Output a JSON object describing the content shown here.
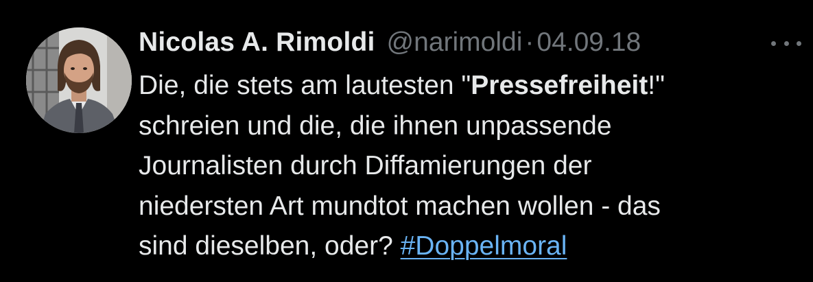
{
  "tweet": {
    "author": {
      "display_name": "Nicolas A. Rimoldi",
      "handle": "@narimoldi",
      "avatar_icon": "profile-photo"
    },
    "separator": "·",
    "date": "04.09.18",
    "more_icon": "ellipsis-icon",
    "text": {
      "line1_a": "Die, die stets am lautesten \"",
      "line1_bold": "Pressefreiheit",
      "line1_b": "!\"",
      "line2": "schreien und die, die ihnen unpassende",
      "line3": "Journalisten durch Diffamierungen der",
      "line4": "niedersten Art mundtot machen wollen - das",
      "line5_a": "sind dieselben, oder? ",
      "hashtag": "#Doppelmoral"
    }
  },
  "colors": {
    "background": "#000000",
    "primary_text": "#e7e9ea",
    "secondary_text": "#71767b",
    "link": "#6ab4f5"
  }
}
